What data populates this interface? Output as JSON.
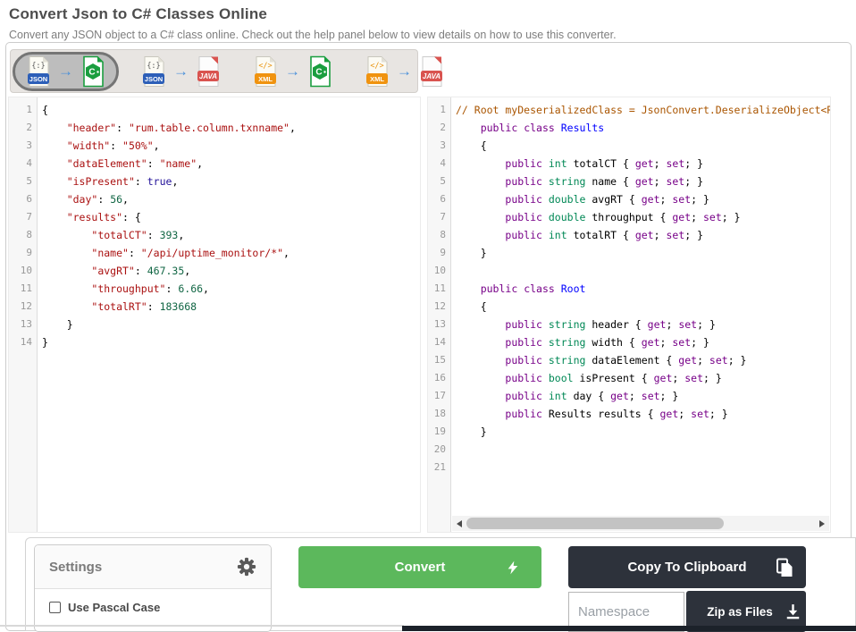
{
  "page": {
    "title": "Convert Json to C# Classes Online",
    "subtitle": "Convert any JSON object to a C# class online. Check out the help panel below to view details on how to use this converter."
  },
  "toolbar": {
    "arrow_glyph": "→",
    "modes": [
      {
        "from": "JSON",
        "to": "CSHARP",
        "selected": true
      },
      {
        "from": "JSON",
        "to": "JAVA",
        "selected": false
      },
      {
        "from": "XML",
        "to": "CSHARP",
        "selected": false
      },
      {
        "from": "XML",
        "to": "JAVA",
        "selected": false
      }
    ]
  },
  "icons": {
    "json": {
      "glyph": "{:}",
      "label": "JSON",
      "color": "#2d5fb8"
    },
    "xml": {
      "glyph": "</>",
      "label": "XML",
      "color": "#f0930f"
    },
    "java": {
      "label": "JAVA",
      "color": "#d9534f"
    },
    "csharp": {
      "letter": "C",
      "color": "#1a9e3f"
    }
  },
  "editors": {
    "json_input": {
      "lines": [
        [
          [
            "{",
            ""
          ]
        ],
        [
          [
            "    ",
            ""
          ],
          [
            "\"header\"",
            "str"
          ],
          [
            ": ",
            ""
          ],
          [
            "\"rum.table.column.txnname\"",
            "str"
          ],
          [
            ",",
            ""
          ]
        ],
        [
          [
            "    ",
            ""
          ],
          [
            "\"width\"",
            "str"
          ],
          [
            ": ",
            ""
          ],
          [
            "\"50%\"",
            "str"
          ],
          [
            ",",
            ""
          ]
        ],
        [
          [
            "    ",
            ""
          ],
          [
            "\"dataElement\"",
            "str"
          ],
          [
            ": ",
            ""
          ],
          [
            "\"name\"",
            "str"
          ],
          [
            ",",
            ""
          ]
        ],
        [
          [
            "    ",
            ""
          ],
          [
            "\"isPresent\"",
            "str"
          ],
          [
            ": ",
            ""
          ],
          [
            "true",
            "atom"
          ],
          [
            ",",
            ""
          ]
        ],
        [
          [
            "    ",
            ""
          ],
          [
            "\"day\"",
            "str"
          ],
          [
            ": ",
            ""
          ],
          [
            "56",
            "num"
          ],
          [
            ",",
            ""
          ]
        ],
        [
          [
            "    ",
            ""
          ],
          [
            "\"results\"",
            "str"
          ],
          [
            ": {",
            ""
          ]
        ],
        [
          [
            "        ",
            ""
          ],
          [
            "\"totalCT\"",
            "str"
          ],
          [
            ": ",
            ""
          ],
          [
            "393",
            "num"
          ],
          [
            ",",
            ""
          ]
        ],
        [
          [
            "        ",
            ""
          ],
          [
            "\"name\"",
            "str"
          ],
          [
            ": ",
            ""
          ],
          [
            "\"/api/uptime_monitor/*\"",
            "str"
          ],
          [
            ",",
            ""
          ]
        ],
        [
          [
            "        ",
            ""
          ],
          [
            "\"avgRT\"",
            "str"
          ],
          [
            ": ",
            ""
          ],
          [
            "467.35",
            "num"
          ],
          [
            ",",
            ""
          ]
        ],
        [
          [
            "        ",
            ""
          ],
          [
            "\"throughput\"",
            "str"
          ],
          [
            ": ",
            ""
          ],
          [
            "6.66",
            "num"
          ],
          [
            ",",
            ""
          ]
        ],
        [
          [
            "        ",
            ""
          ],
          [
            "\"totalRT\"",
            "str"
          ],
          [
            ": ",
            ""
          ],
          [
            "183668",
            "num"
          ]
        ],
        [
          [
            "    }",
            ""
          ]
        ],
        [
          [
            "}",
            ""
          ]
        ]
      ]
    },
    "csharp_output": {
      "lines": [
        [
          [
            "// Root myDeserializedClass = JsonConvert.DeserializeObject<R",
            "cmt"
          ]
        ],
        [
          [
            "    ",
            ""
          ],
          [
            "public",
            "kw"
          ],
          [
            " ",
            ""
          ],
          [
            "class",
            "kw"
          ],
          [
            " ",
            ""
          ],
          [
            "Results",
            "def"
          ]
        ],
        [
          [
            "    {",
            ""
          ]
        ],
        [
          [
            "        ",
            ""
          ],
          [
            "public",
            "kw"
          ],
          [
            " ",
            ""
          ],
          [
            "int",
            "type"
          ],
          [
            " totalCT { ",
            ""
          ],
          [
            "get",
            "kw"
          ],
          [
            "; ",
            ""
          ],
          [
            "set",
            "kw"
          ],
          [
            "; }",
            ""
          ]
        ],
        [
          [
            "        ",
            ""
          ],
          [
            "public",
            "kw"
          ],
          [
            " ",
            ""
          ],
          [
            "string",
            "type"
          ],
          [
            " name { ",
            ""
          ],
          [
            "get",
            "kw"
          ],
          [
            "; ",
            ""
          ],
          [
            "set",
            "kw"
          ],
          [
            "; }",
            ""
          ]
        ],
        [
          [
            "        ",
            ""
          ],
          [
            "public",
            "kw"
          ],
          [
            " ",
            ""
          ],
          [
            "double",
            "type"
          ],
          [
            " avgRT { ",
            ""
          ],
          [
            "get",
            "kw"
          ],
          [
            "; ",
            ""
          ],
          [
            "set",
            "kw"
          ],
          [
            "; }",
            ""
          ]
        ],
        [
          [
            "        ",
            ""
          ],
          [
            "public",
            "kw"
          ],
          [
            " ",
            ""
          ],
          [
            "double",
            "type"
          ],
          [
            " throughput { ",
            ""
          ],
          [
            "get",
            "kw"
          ],
          [
            "; ",
            ""
          ],
          [
            "set",
            "kw"
          ],
          [
            "; }",
            ""
          ]
        ],
        [
          [
            "        ",
            ""
          ],
          [
            "public",
            "kw"
          ],
          [
            " ",
            ""
          ],
          [
            "int",
            "type"
          ],
          [
            " totalRT { ",
            ""
          ],
          [
            "get",
            "kw"
          ],
          [
            "; ",
            ""
          ],
          [
            "set",
            "kw"
          ],
          [
            "; }",
            ""
          ]
        ],
        [
          [
            "    }",
            ""
          ]
        ],
        [],
        [
          [
            "    ",
            ""
          ],
          [
            "public",
            "kw"
          ],
          [
            " ",
            ""
          ],
          [
            "class",
            "kw"
          ],
          [
            " ",
            ""
          ],
          [
            "Root",
            "def"
          ]
        ],
        [
          [
            "    {",
            ""
          ]
        ],
        [
          [
            "        ",
            ""
          ],
          [
            "public",
            "kw"
          ],
          [
            " ",
            ""
          ],
          [
            "string",
            "type"
          ],
          [
            " header { ",
            ""
          ],
          [
            "get",
            "kw"
          ],
          [
            "; ",
            ""
          ],
          [
            "set",
            "kw"
          ],
          [
            "; }",
            ""
          ]
        ],
        [
          [
            "        ",
            ""
          ],
          [
            "public",
            "kw"
          ],
          [
            " ",
            ""
          ],
          [
            "string",
            "type"
          ],
          [
            " width { ",
            ""
          ],
          [
            "get",
            "kw"
          ],
          [
            "; ",
            ""
          ],
          [
            "set",
            "kw"
          ],
          [
            "; }",
            ""
          ]
        ],
        [
          [
            "        ",
            ""
          ],
          [
            "public",
            "kw"
          ],
          [
            " ",
            ""
          ],
          [
            "string",
            "type"
          ],
          [
            " dataElement { ",
            ""
          ],
          [
            "get",
            "kw"
          ],
          [
            "; ",
            ""
          ],
          [
            "set",
            "kw"
          ],
          [
            "; }",
            ""
          ]
        ],
        [
          [
            "        ",
            ""
          ],
          [
            "public",
            "kw"
          ],
          [
            " ",
            ""
          ],
          [
            "bool",
            "type"
          ],
          [
            " isPresent { ",
            ""
          ],
          [
            "get",
            "kw"
          ],
          [
            "; ",
            ""
          ],
          [
            "set",
            "kw"
          ],
          [
            "; }",
            ""
          ]
        ],
        [
          [
            "        ",
            ""
          ],
          [
            "public",
            "kw"
          ],
          [
            " ",
            ""
          ],
          [
            "int",
            "type"
          ],
          [
            " day { ",
            ""
          ],
          [
            "get",
            "kw"
          ],
          [
            "; ",
            ""
          ],
          [
            "set",
            "kw"
          ],
          [
            "; }",
            ""
          ]
        ],
        [
          [
            "        ",
            ""
          ],
          [
            "public",
            "kw"
          ],
          [
            " Results results { ",
            ""
          ],
          [
            "get",
            "kw"
          ],
          [
            "; ",
            ""
          ],
          [
            "set",
            "kw"
          ],
          [
            "; }",
            ""
          ]
        ],
        [
          [
            "    }",
            ""
          ]
        ],
        [],
        []
      ]
    }
  },
  "settings": {
    "title": "Settings",
    "options": [
      {
        "label": "Use Pascal Case",
        "checked": false
      }
    ]
  },
  "actions": {
    "convert_label": "Convert",
    "copy_label": "Copy To Clipboard",
    "namespace_placeholder": "Namespace",
    "zip_label": "Zip as Files"
  },
  "colors": {
    "accent_green": "#5cb85c",
    "dark_button": "#2d323b",
    "arrow_blue": "#4a90d9",
    "token_string": "#a11",
    "token_number": "#164",
    "token_atom": "#219",
    "token_keyword": "#708",
    "token_def": "#00f",
    "token_type": "#085",
    "token_comment": "#a50"
  }
}
